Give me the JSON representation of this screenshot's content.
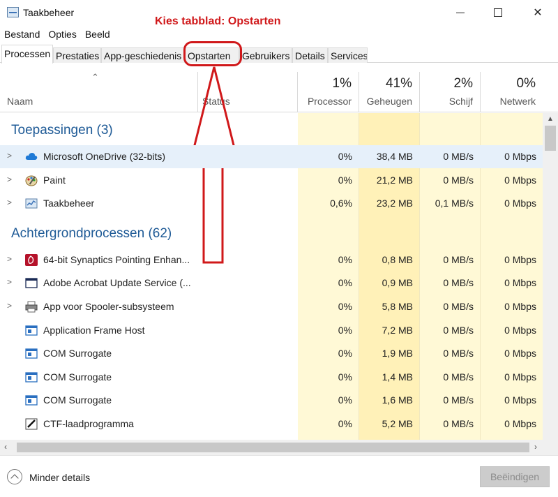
{
  "window": {
    "title": "Taakbeheer"
  },
  "menu": [
    "Bestand",
    "Opties",
    "Beeld"
  ],
  "annotation": "Kies tabblad: Opstarten",
  "tabs": [
    "Processen",
    "Prestaties",
    "App-geschiedenis",
    "Opstarten",
    "Gebruikers",
    "Details",
    "Services"
  ],
  "active_tab": "Processen",
  "columns": {
    "name": "Naam",
    "status": "Status",
    "cpu": {
      "pct": "1%",
      "label": "Processor"
    },
    "memory": {
      "pct": "41%",
      "label": "Geheugen"
    },
    "disk": {
      "pct": "2%",
      "label": "Schijf"
    },
    "network": {
      "pct": "0%",
      "label": "Netwerk"
    }
  },
  "groups": [
    {
      "label": "Toepassingen (3)",
      "rows": [
        {
          "name": "Microsoft OneDrive (32-bits)",
          "icon": "cloud-icon",
          "expandable": true,
          "selected": true,
          "cpu": "0%",
          "mem": "38,4 MB",
          "disk": "0 MB/s",
          "net": "0 Mbps"
        },
        {
          "name": "Paint",
          "icon": "paint-icon",
          "expandable": true,
          "cpu": "0%",
          "mem": "21,2 MB",
          "disk": "0 MB/s",
          "net": "0 Mbps"
        },
        {
          "name": "Taakbeheer",
          "icon": "task-manager-icon",
          "expandable": true,
          "cpu": "0,6%",
          "mem": "23,2 MB",
          "disk": "0,1 MB/s",
          "net": "0 Mbps"
        }
      ]
    },
    {
      "label": "Achtergrondprocessen (62)",
      "rows": [
        {
          "name": "64-bit Synaptics Pointing Enhan...",
          "icon": "synaptics-icon",
          "expandable": true,
          "cpu": "0%",
          "mem": "0,8 MB",
          "disk": "0 MB/s",
          "net": "0 Mbps"
        },
        {
          "name": "Adobe Acrobat Update Service (...",
          "icon": "window-icon",
          "expandable": true,
          "cpu": "0%",
          "mem": "0,9 MB",
          "disk": "0 MB/s",
          "net": "0 Mbps"
        },
        {
          "name": "App voor Spooler-subsysteem",
          "icon": "printer-icon",
          "expandable": true,
          "cpu": "0%",
          "mem": "5,8 MB",
          "disk": "0 MB/s",
          "net": "0 Mbps"
        },
        {
          "name": "Application Frame Host",
          "icon": "app-frame-icon",
          "expandable": false,
          "cpu": "0%",
          "mem": "7,2 MB",
          "disk": "0 MB/s",
          "net": "0 Mbps"
        },
        {
          "name": "COM Surrogate",
          "icon": "app-frame-icon",
          "expandable": false,
          "cpu": "0%",
          "mem": "1,9 MB",
          "disk": "0 MB/s",
          "net": "0 Mbps"
        },
        {
          "name": "COM Surrogate",
          "icon": "app-frame-icon",
          "expandable": false,
          "cpu": "0%",
          "mem": "1,4 MB",
          "disk": "0 MB/s",
          "net": "0 Mbps"
        },
        {
          "name": "COM Surrogate",
          "icon": "app-frame-icon",
          "expandable": false,
          "cpu": "0%",
          "mem": "1,6 MB",
          "disk": "0 MB/s",
          "net": "0 Mbps"
        },
        {
          "name": "CTF-laadprogramma",
          "icon": "pen-icon",
          "expandable": false,
          "cpu": "0%",
          "mem": "5,2 MB",
          "disk": "0 MB/s",
          "net": "0 Mbps"
        }
      ]
    }
  ],
  "footer": {
    "less_details": "Minder details",
    "end_task": "Beëindigen"
  },
  "colors": {
    "group_label": "#1e5a96",
    "annotation": "#d0181a",
    "selected_row": "#e6f0fa"
  }
}
